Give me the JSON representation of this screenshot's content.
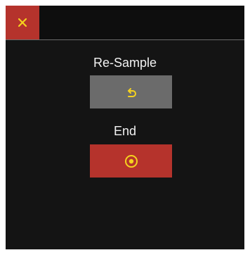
{
  "window": {
    "close_icon": "close-x-icon"
  },
  "actions": {
    "resample": {
      "label": "Re-Sample",
      "icon": "undo-arrow-icon",
      "color": "#6b6b6b"
    },
    "end": {
      "label": "End",
      "icon": "record-target-icon",
      "color": "#b5332c"
    }
  },
  "colors": {
    "background": "#141414",
    "accent_red": "#b5332c",
    "button_gray": "#6b6b6b",
    "icon_yellow": "#f5d21e",
    "text": "#f2f2f2"
  }
}
